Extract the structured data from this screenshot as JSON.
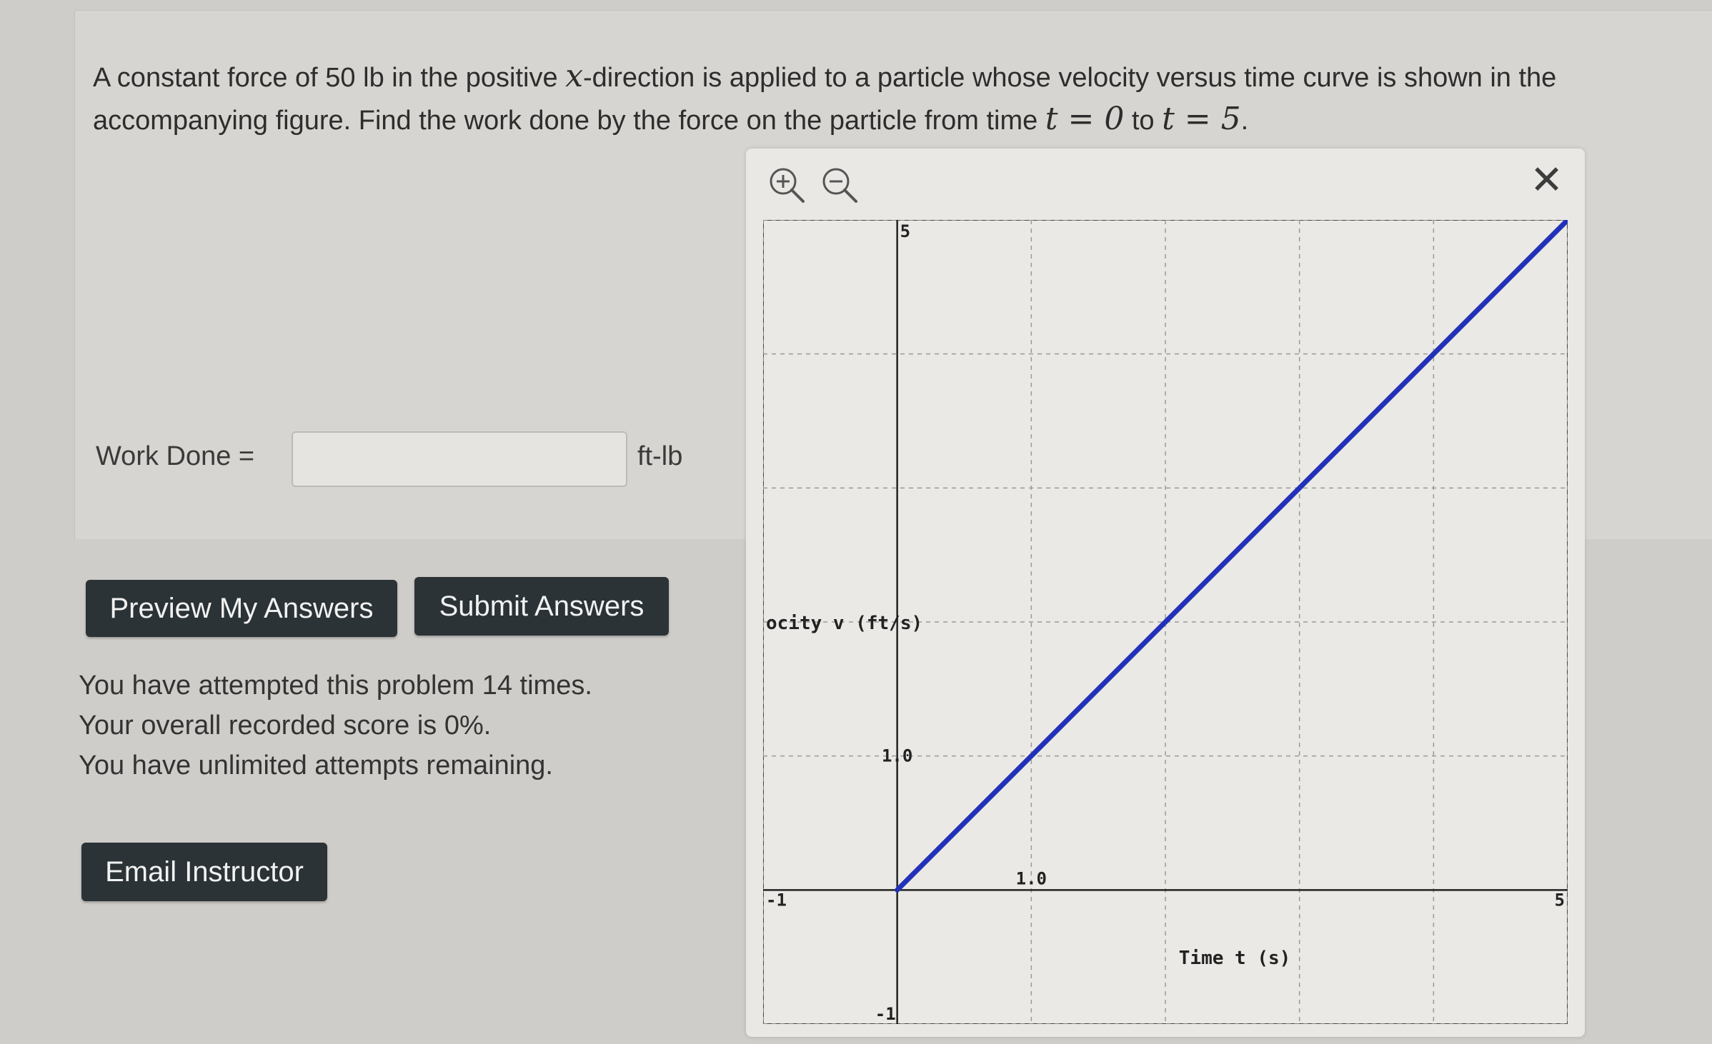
{
  "problem": {
    "p1": "A constant force of 50 lb in the positive ",
    "var_x": "x",
    "p2": "-direction is applied to a particle whose velocity versus time curve is shown in the accompanying figure. Find the work done by the force on the particle from time ",
    "t0": "t = 0",
    "to": " to ",
    "t5": "t = 5",
    "end": "."
  },
  "answer": {
    "label": "Work Done =",
    "value": "",
    "placeholder": "",
    "unit": "ft-lb"
  },
  "buttons": {
    "preview": "Preview My Answers",
    "submit": "Submit Answers",
    "email": "Email Instructor"
  },
  "status": {
    "attempts": "You have attempted this problem 14 times.",
    "score": "Your overall recorded score is 0%.",
    "remaining": "You have unlimited attempts remaining."
  },
  "graph_panel": {
    "icons": [
      "zoom-in-icon",
      "zoom-out-icon",
      "close-icon"
    ],
    "close_glyph": "✕"
  },
  "chart_data": {
    "type": "line",
    "xlim": [
      -1,
      5
    ],
    "ylim": [
      -1,
      5
    ],
    "xlabel": "Time t (s)",
    "ylabel": "ocity v (ft/s)",
    "x_tick_labels": [
      "-1",
      "1.0",
      "5"
    ],
    "y_tick_labels": [
      "-1",
      "1.0",
      "5"
    ],
    "grid": true,
    "line_color": "#2331b8",
    "series": [
      {
        "x": [
          0,
          5
        ],
        "y": [
          0,
          5
        ]
      }
    ]
  }
}
